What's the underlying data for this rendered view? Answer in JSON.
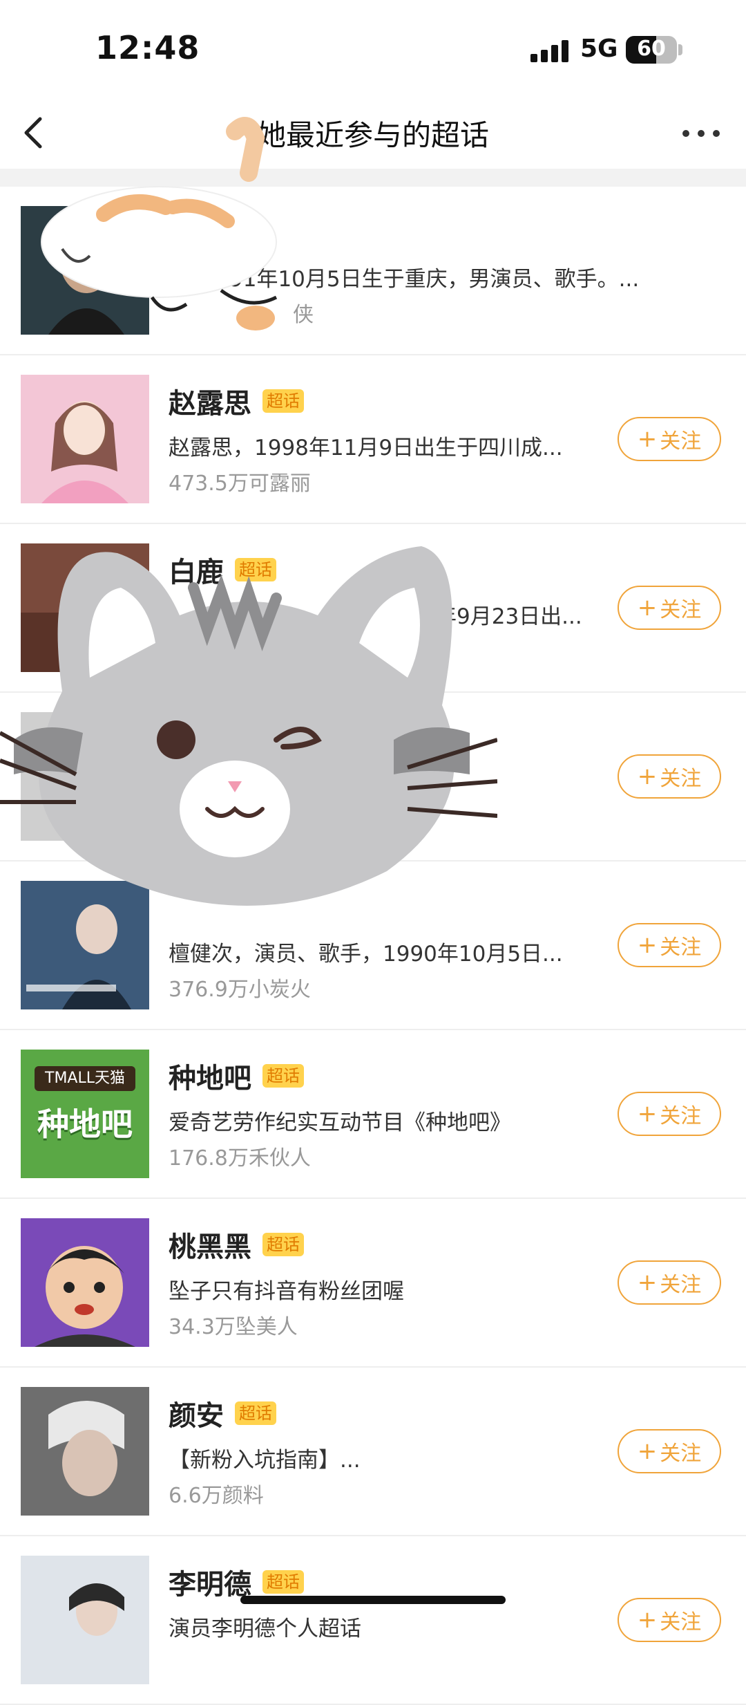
{
  "status_bar": {
    "time": "12:48",
    "network": "5G",
    "battery": "60"
  },
  "header": {
    "title": "她最近参与的超话"
  },
  "badge_label": "超话",
  "follow_label": "关注",
  "items": [
    {
      "name": "",
      "desc": "91年10月5日生于重庆，男演员、歌手。...",
      "fans": "侠",
      "follow": false,
      "thumb_color": "#2c3d44"
    },
    {
      "name": "赵露思",
      "desc": "赵露思，1998年11月9日出生于四川成...",
      "fans": "473.5万可露丽",
      "follow": true,
      "thumb_color": "#f3c6d6"
    },
    {
      "name": "白鹿",
      "desc": "年9月23日出...",
      "fans": "",
      "follow": true,
      "thumb_color": "#7a4a3c"
    },
    {
      "name": "",
      "desc": "",
      "fans": "",
      "follow": true,
      "thumb_color": "#cfcfcf"
    },
    {
      "name": "",
      "desc": "檀健次，演员、歌手，1990年10月5日...",
      "fans": "376.9万小炭火",
      "follow": true,
      "thumb_color": "#3d5a7a"
    },
    {
      "name": "种地吧",
      "desc": "爱奇艺劳作纪实互动节目《种地吧》",
      "fans": "176.8万禾伙人",
      "follow": true,
      "thumb_color": "#5aa845"
    },
    {
      "name": "桃黑黑",
      "desc": "坠子只有抖音有粉丝团喔",
      "fans": "34.3万坠美人",
      "follow": true,
      "thumb_color": "#7a4ab8"
    },
    {
      "name": "颜安",
      "desc": "【新粉入坑指南】...",
      "fans": "6.6万颜料",
      "follow": true,
      "thumb_color": "#6e6e6e"
    },
    {
      "name": "李明德",
      "desc": "演员李明德个人超话",
      "fans": "",
      "follow": true,
      "thumb_color": "#dfe4ea"
    }
  ],
  "tmall_logo_text": "TMALL天猫",
  "zhongdi_logo_text": "种地吧"
}
